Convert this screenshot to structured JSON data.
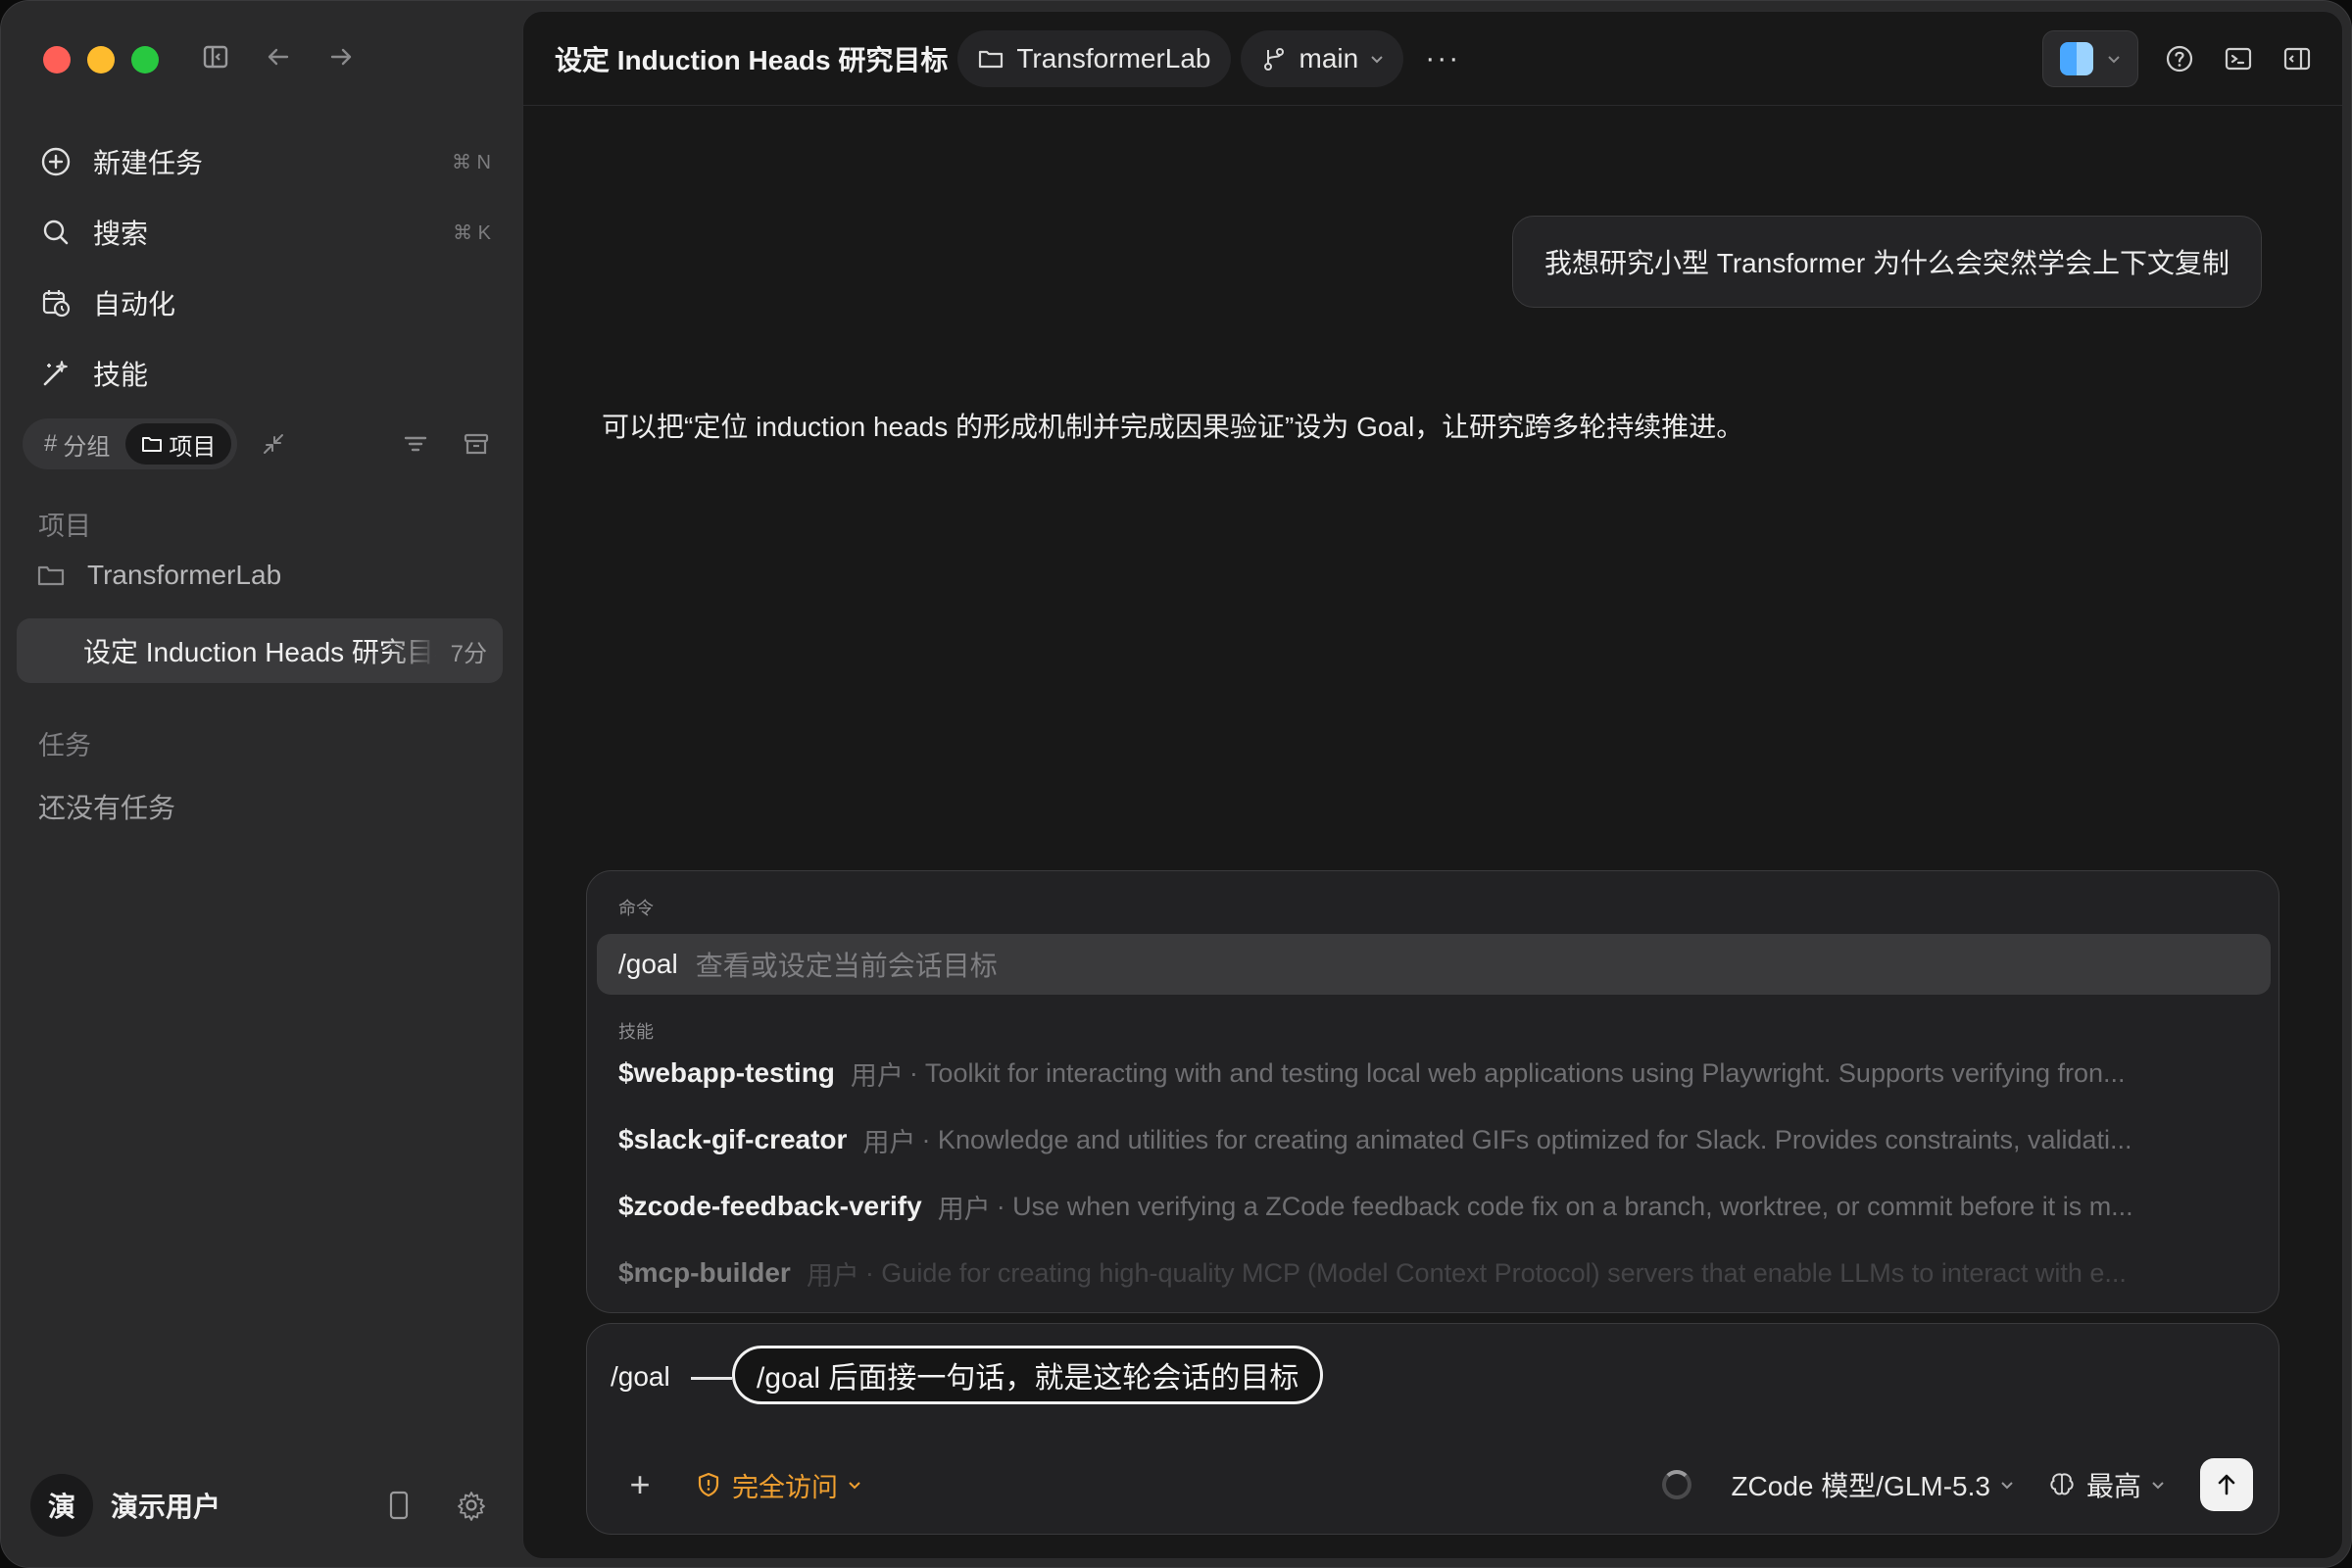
{
  "window": {
    "traffic_lights": {
      "close": "#ff5f57",
      "minimize": "#febc2e",
      "maximize": "#28c840"
    }
  },
  "sidebar": {
    "nav": [
      {
        "label": "新建任务",
        "shortcut": "⌘ N",
        "icon": "plus-circle-icon"
      },
      {
        "label": "搜索",
        "shortcut": "⌘ K",
        "icon": "search-icon"
      },
      {
        "label": "自动化",
        "shortcut": "",
        "icon": "calendar-clock-icon"
      },
      {
        "label": "技能",
        "shortcut": "",
        "icon": "wand-icon"
      }
    ],
    "segments": {
      "group_label": "分组",
      "project_label": "项目",
      "active": "project"
    },
    "projects_title": "项目",
    "project_name": "TransformerLab",
    "active_task": {
      "label": "设定 Induction Heads 研究目标",
      "time": "7分"
    },
    "tasks_title": "任务",
    "tasks_empty": "还没有任务",
    "user": {
      "avatar_char": "演",
      "name": "演示用户"
    }
  },
  "header": {
    "title": "设定 Induction Heads 研究目标",
    "project": "TransformerLab",
    "branch": "main",
    "more": "···"
  },
  "chat": {
    "user_message": "我想研究小型 Transformer 为什么会突然学会上下文复制",
    "assistant_message": "可以把“定位 induction heads 的形成机制并完成因果验证”设为 Goal，让研究跨多轮持续推进。"
  },
  "palette": {
    "commands_title": "命令",
    "goal": {
      "command": "/goal",
      "description": "查看或设定当前会话目标"
    },
    "skills_title": "技能",
    "skills": [
      {
        "name": "$webapp-testing",
        "source": "用户",
        "description": "· Toolkit for interacting with and testing local web applications using Playwright. Supports verifying fron..."
      },
      {
        "name": "$slack-gif-creator",
        "source": "用户",
        "description": "· Knowledge and utilities for creating animated GIFs optimized for Slack. Provides constraints, validati..."
      },
      {
        "name": "$zcode-feedback-verify",
        "source": "用户",
        "description": "· Use when verifying a ZCode feedback code fix on a branch, worktree, or commit before it is m..."
      },
      {
        "name": "$mcp-builder",
        "source": "用户",
        "description": "· Guide for creating high-quality MCP (Model Context Protocol) servers that enable LLMs to interact with e..."
      }
    ]
  },
  "composer": {
    "typed_text": "/goal",
    "callout": "/goal 后面接一句话，就是这轮会话的目标",
    "plus": "+",
    "access": "完全访问",
    "access_color": "#f0a030",
    "model": "ZCode 模型/GLM-5.3",
    "effort": "最高"
  }
}
